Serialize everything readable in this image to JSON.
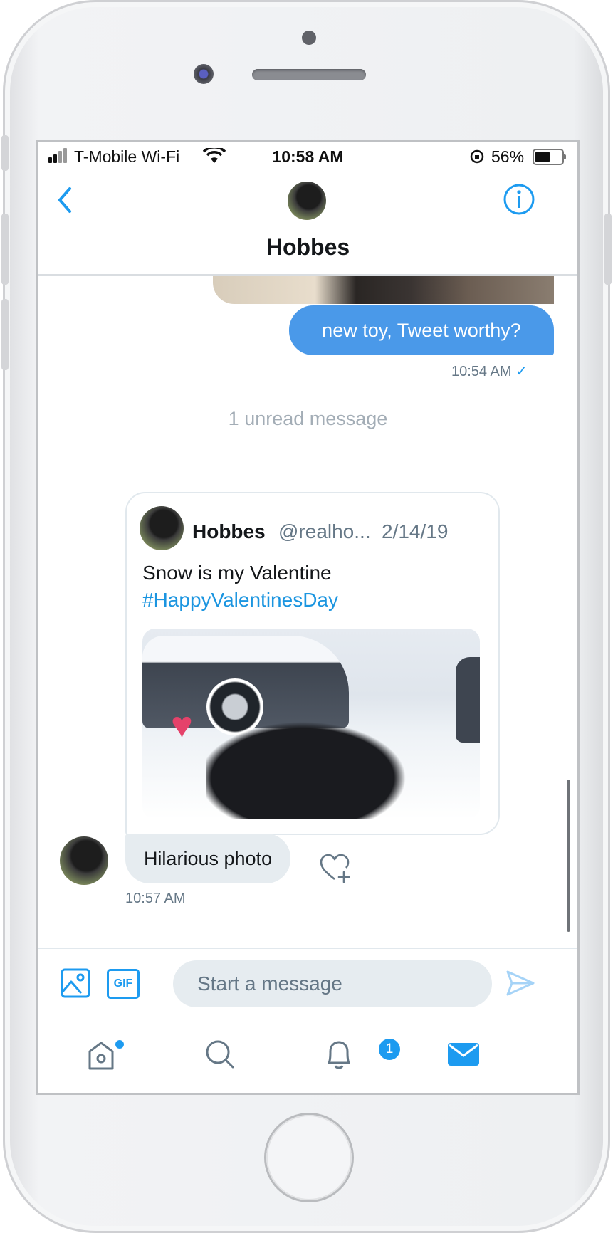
{
  "status_bar": {
    "carrier": "T-Mobile Wi-Fi",
    "time": "10:58 AM",
    "battery_percent": "56%"
  },
  "header": {
    "title": "Hobbes",
    "back_icon": "chevron-left-icon",
    "info_icon": "info-icon"
  },
  "conversation": {
    "outgoing_message": "new toy, Tweet worthy?",
    "outgoing_time": "10:54 AM",
    "outgoing_status": "✓",
    "unread_divider": "1 unread message",
    "shared_tweet": {
      "name": "Hobbes",
      "handle": "@realho...",
      "date": "2/14/19",
      "text": "Snow is my Valentine",
      "hashtag": "#HappyValentinesDay"
    },
    "incoming_message": "Hilarious photo",
    "incoming_time": "10:57 AM"
  },
  "composer": {
    "placeholder": "Start a message",
    "gif_label": "GIF"
  },
  "tabbar": {
    "notifications_badge": "1"
  },
  "colors": {
    "accent": "#1d9bf0",
    "outgoing_bubble": "#4a99e9",
    "incoming_bubble": "#e6ecf0"
  }
}
